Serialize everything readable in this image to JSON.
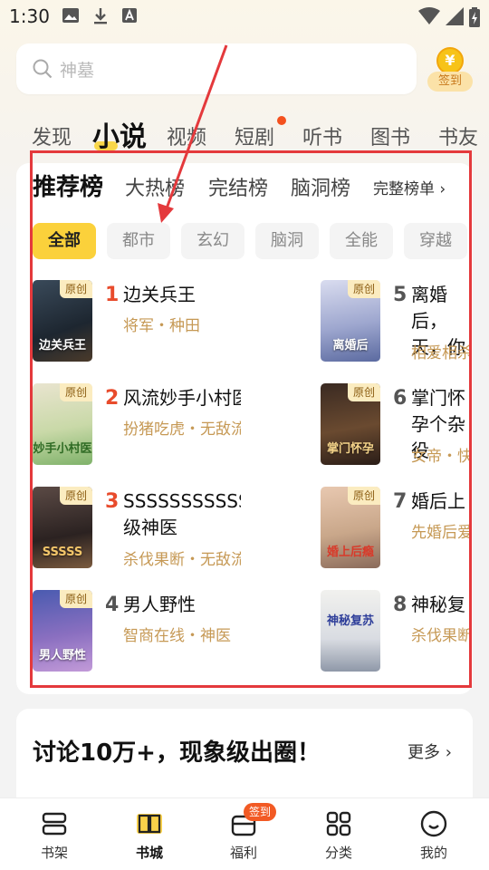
{
  "status_bar": {
    "time": "1:30"
  },
  "search": {
    "placeholder": "神墓"
  },
  "signin": {
    "coin_symbol": "¥",
    "label": "签到"
  },
  "category_tabs": [
    {
      "label": "发现"
    },
    {
      "label": "小说",
      "active": true
    },
    {
      "label": "视频"
    },
    {
      "label": "短剧",
      "has_dot": true
    },
    {
      "label": "听书"
    },
    {
      "label": "图书"
    },
    {
      "label": "书友"
    }
  ],
  "ranking_tabs": [
    {
      "label": "推荐榜",
      "active": true
    },
    {
      "label": "大热榜"
    },
    {
      "label": "完结榜"
    },
    {
      "label": "脑洞榜"
    }
  ],
  "ranking_more": "完整榜单",
  "genre_chips": [
    {
      "label": "全部",
      "active": true
    },
    {
      "label": "都市"
    },
    {
      "label": "玄幻"
    },
    {
      "label": "脑洞"
    },
    {
      "label": "全能"
    },
    {
      "label": "穿越"
    }
  ],
  "books": [
    {
      "rank": "1",
      "title": "边关兵王",
      "tags": "将军・种田",
      "badge": "原创",
      "cover_text": "边关兵王"
    },
    {
      "rank": "2",
      "title": "风流妙手小村医",
      "tags": "扮猪吃虎・无敌流",
      "badge": "原创",
      "cover_text": "妙手小村医"
    },
    {
      "rank": "3",
      "title": "SSSSSSSSSSSSSS满级神医",
      "tags": "杀伐果断・无敌流",
      "badge": "原创",
      "cover_text": "SSSSS"
    },
    {
      "rank": "4",
      "title": "男人野性",
      "tags": "智商在线・神医",
      "badge": "原创",
      "cover_text": "男人野性"
    },
    {
      "rank": "5",
      "title": "离婚后，天，你",
      "tags": "相爱相杀",
      "badge": "原创",
      "cover_text": "离婚后"
    },
    {
      "rank": "6",
      "title": "掌门怀孕个杂役",
      "tags": "女帝・快",
      "badge": "原创",
      "cover_text": "掌门怀孕"
    },
    {
      "rank": "7",
      "title": "婚后上",
      "tags": "先婚后爱",
      "badge": "原创",
      "cover_text": "婚上后瘾"
    },
    {
      "rank": "8",
      "title": "神秘复",
      "tags": "杀伐果断",
      "badge": "",
      "cover_text": "神秘复苏"
    }
  ],
  "discussion": {
    "title": "讨论10万+，现象级出圈！",
    "more": "更多"
  },
  "bottom_nav": [
    {
      "label": "书架"
    },
    {
      "label": "书城",
      "active": true
    },
    {
      "label": "福利",
      "badge": "签到"
    },
    {
      "label": "分类"
    },
    {
      "label": "我的"
    }
  ],
  "colors": {
    "accent_yellow": "#fbd13b",
    "rank_red": "#e84b2c",
    "tag_gold": "#c69955",
    "annotation_red": "#e4393c"
  }
}
